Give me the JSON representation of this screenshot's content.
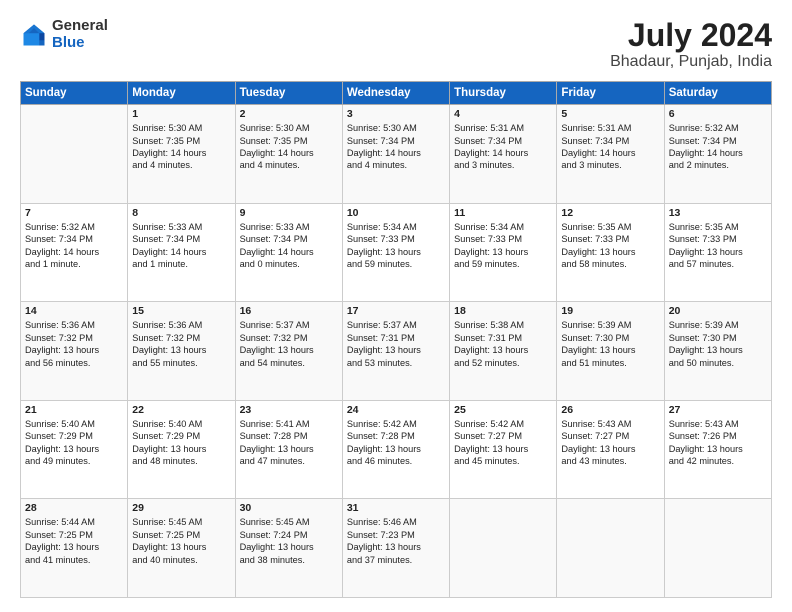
{
  "logo": {
    "general": "General",
    "blue": "Blue"
  },
  "title": "July 2024",
  "subtitle": "Bhadaur, Punjab, India",
  "header_days": [
    "Sunday",
    "Monday",
    "Tuesday",
    "Wednesday",
    "Thursday",
    "Friday",
    "Saturday"
  ],
  "weeks": [
    [
      {
        "num": "",
        "lines": []
      },
      {
        "num": "1",
        "lines": [
          "Sunrise: 5:30 AM",
          "Sunset: 7:35 PM",
          "Daylight: 14 hours",
          "and 4 minutes."
        ]
      },
      {
        "num": "2",
        "lines": [
          "Sunrise: 5:30 AM",
          "Sunset: 7:35 PM",
          "Daylight: 14 hours",
          "and 4 minutes."
        ]
      },
      {
        "num": "3",
        "lines": [
          "Sunrise: 5:30 AM",
          "Sunset: 7:34 PM",
          "Daylight: 14 hours",
          "and 4 minutes."
        ]
      },
      {
        "num": "4",
        "lines": [
          "Sunrise: 5:31 AM",
          "Sunset: 7:34 PM",
          "Daylight: 14 hours",
          "and 3 minutes."
        ]
      },
      {
        "num": "5",
        "lines": [
          "Sunrise: 5:31 AM",
          "Sunset: 7:34 PM",
          "Daylight: 14 hours",
          "and 3 minutes."
        ]
      },
      {
        "num": "6",
        "lines": [
          "Sunrise: 5:32 AM",
          "Sunset: 7:34 PM",
          "Daylight: 14 hours",
          "and 2 minutes."
        ]
      }
    ],
    [
      {
        "num": "7",
        "lines": [
          "Sunrise: 5:32 AM",
          "Sunset: 7:34 PM",
          "Daylight: 14 hours",
          "and 1 minute."
        ]
      },
      {
        "num": "8",
        "lines": [
          "Sunrise: 5:33 AM",
          "Sunset: 7:34 PM",
          "Daylight: 14 hours",
          "and 1 minute."
        ]
      },
      {
        "num": "9",
        "lines": [
          "Sunrise: 5:33 AM",
          "Sunset: 7:34 PM",
          "Daylight: 14 hours",
          "and 0 minutes."
        ]
      },
      {
        "num": "10",
        "lines": [
          "Sunrise: 5:34 AM",
          "Sunset: 7:33 PM",
          "Daylight: 13 hours",
          "and 59 minutes."
        ]
      },
      {
        "num": "11",
        "lines": [
          "Sunrise: 5:34 AM",
          "Sunset: 7:33 PM",
          "Daylight: 13 hours",
          "and 59 minutes."
        ]
      },
      {
        "num": "12",
        "lines": [
          "Sunrise: 5:35 AM",
          "Sunset: 7:33 PM",
          "Daylight: 13 hours",
          "and 58 minutes."
        ]
      },
      {
        "num": "13",
        "lines": [
          "Sunrise: 5:35 AM",
          "Sunset: 7:33 PM",
          "Daylight: 13 hours",
          "and 57 minutes."
        ]
      }
    ],
    [
      {
        "num": "14",
        "lines": [
          "Sunrise: 5:36 AM",
          "Sunset: 7:32 PM",
          "Daylight: 13 hours",
          "and 56 minutes."
        ]
      },
      {
        "num": "15",
        "lines": [
          "Sunrise: 5:36 AM",
          "Sunset: 7:32 PM",
          "Daylight: 13 hours",
          "and 55 minutes."
        ]
      },
      {
        "num": "16",
        "lines": [
          "Sunrise: 5:37 AM",
          "Sunset: 7:32 PM",
          "Daylight: 13 hours",
          "and 54 minutes."
        ]
      },
      {
        "num": "17",
        "lines": [
          "Sunrise: 5:37 AM",
          "Sunset: 7:31 PM",
          "Daylight: 13 hours",
          "and 53 minutes."
        ]
      },
      {
        "num": "18",
        "lines": [
          "Sunrise: 5:38 AM",
          "Sunset: 7:31 PM",
          "Daylight: 13 hours",
          "and 52 minutes."
        ]
      },
      {
        "num": "19",
        "lines": [
          "Sunrise: 5:39 AM",
          "Sunset: 7:30 PM",
          "Daylight: 13 hours",
          "and 51 minutes."
        ]
      },
      {
        "num": "20",
        "lines": [
          "Sunrise: 5:39 AM",
          "Sunset: 7:30 PM",
          "Daylight: 13 hours",
          "and 50 minutes."
        ]
      }
    ],
    [
      {
        "num": "21",
        "lines": [
          "Sunrise: 5:40 AM",
          "Sunset: 7:29 PM",
          "Daylight: 13 hours",
          "and 49 minutes."
        ]
      },
      {
        "num": "22",
        "lines": [
          "Sunrise: 5:40 AM",
          "Sunset: 7:29 PM",
          "Daylight: 13 hours",
          "and 48 minutes."
        ]
      },
      {
        "num": "23",
        "lines": [
          "Sunrise: 5:41 AM",
          "Sunset: 7:28 PM",
          "Daylight: 13 hours",
          "and 47 minutes."
        ]
      },
      {
        "num": "24",
        "lines": [
          "Sunrise: 5:42 AM",
          "Sunset: 7:28 PM",
          "Daylight: 13 hours",
          "and 46 minutes."
        ]
      },
      {
        "num": "25",
        "lines": [
          "Sunrise: 5:42 AM",
          "Sunset: 7:27 PM",
          "Daylight: 13 hours",
          "and 45 minutes."
        ]
      },
      {
        "num": "26",
        "lines": [
          "Sunrise: 5:43 AM",
          "Sunset: 7:27 PM",
          "Daylight: 13 hours",
          "and 43 minutes."
        ]
      },
      {
        "num": "27",
        "lines": [
          "Sunrise: 5:43 AM",
          "Sunset: 7:26 PM",
          "Daylight: 13 hours",
          "and 42 minutes."
        ]
      }
    ],
    [
      {
        "num": "28",
        "lines": [
          "Sunrise: 5:44 AM",
          "Sunset: 7:25 PM",
          "Daylight: 13 hours",
          "and 41 minutes."
        ]
      },
      {
        "num": "29",
        "lines": [
          "Sunrise: 5:45 AM",
          "Sunset: 7:25 PM",
          "Daylight: 13 hours",
          "and 40 minutes."
        ]
      },
      {
        "num": "30",
        "lines": [
          "Sunrise: 5:45 AM",
          "Sunset: 7:24 PM",
          "Daylight: 13 hours",
          "and 38 minutes."
        ]
      },
      {
        "num": "31",
        "lines": [
          "Sunrise: 5:46 AM",
          "Sunset: 7:23 PM",
          "Daylight: 13 hours",
          "and 37 minutes."
        ]
      },
      {
        "num": "",
        "lines": []
      },
      {
        "num": "",
        "lines": []
      },
      {
        "num": "",
        "lines": []
      }
    ]
  ]
}
